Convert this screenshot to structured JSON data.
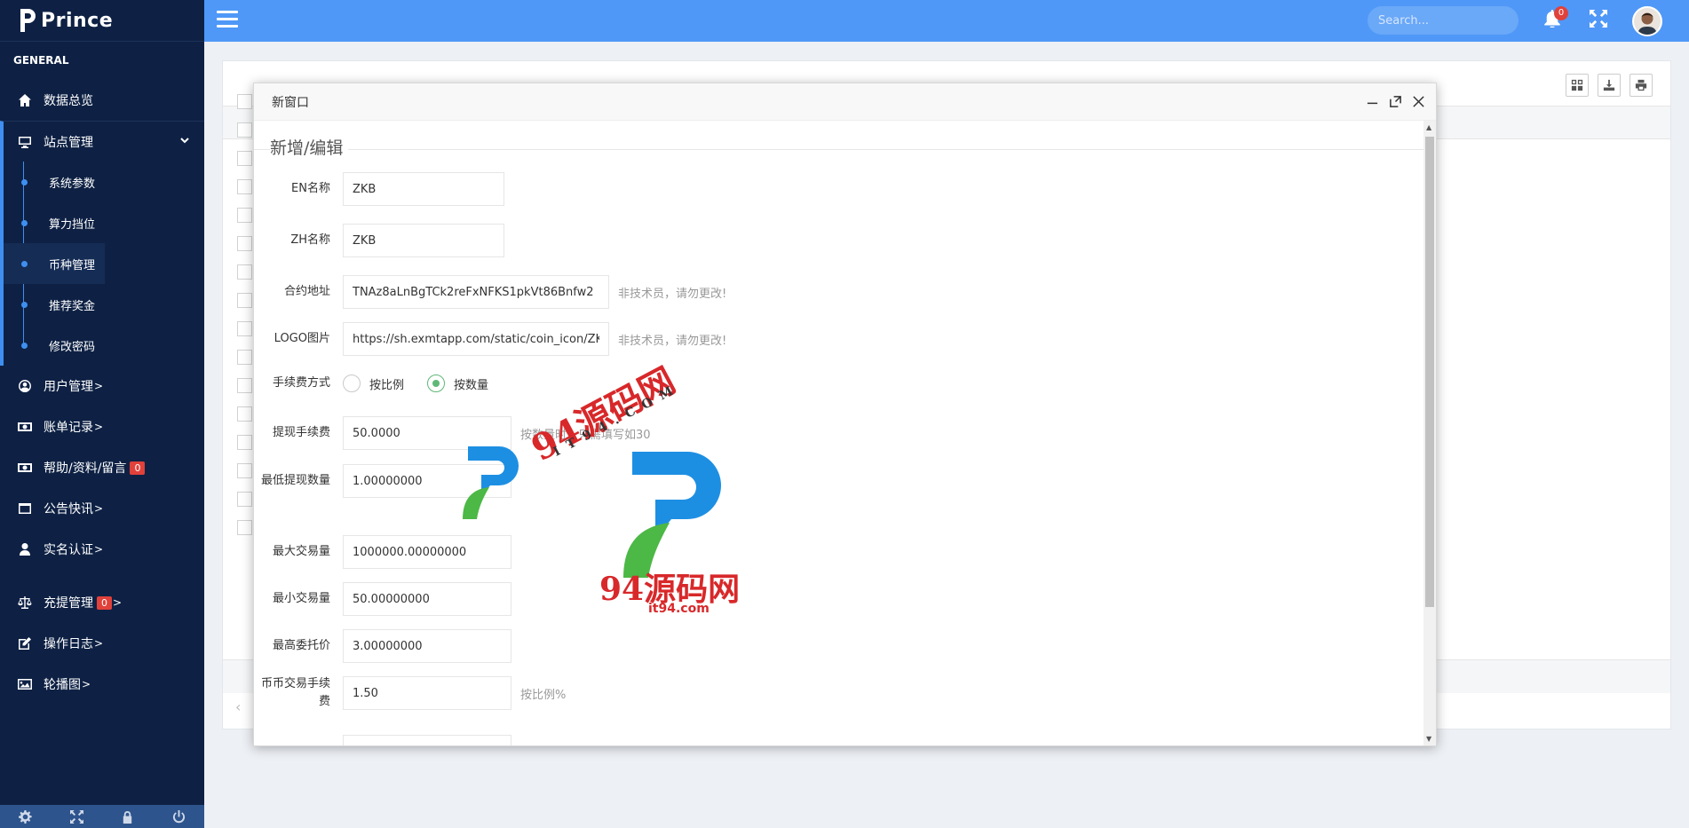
{
  "brand": {
    "name": "Prince"
  },
  "sidebar": {
    "section_title": "GENERAL",
    "items": [
      {
        "label": "数据总览",
        "icon": "home-icon"
      },
      {
        "label": "站点管理",
        "icon": "monitor-icon"
      },
      {
        "label": "用户管理",
        "icon": "user-circle-icon"
      },
      {
        "label": "账单记录",
        "icon": "money-icon"
      },
      {
        "label": "帮助/资料/留言",
        "icon": "money-icon",
        "badge": "0"
      },
      {
        "label": "公告快讯",
        "icon": "window-icon"
      },
      {
        "label": "实名认证",
        "icon": "user-icon"
      },
      {
        "label": "充提管理",
        "icon": "balance-scale-icon",
        "badge": "0"
      },
      {
        "label": "操作日志",
        "icon": "edit-icon"
      },
      {
        "label": "轮播图",
        "icon": "image-icon"
      }
    ],
    "subitems": [
      "系统参数",
      "算力挡位",
      "币种管理",
      "推荐奖金",
      "修改密码"
    ],
    "chevron": ">",
    "footer_icons": [
      "gear-icon",
      "expand-icon",
      "lock-icon",
      "power-icon"
    ]
  },
  "header": {
    "search_placeholder": "Search...",
    "notification_count": "0"
  },
  "dialog": {
    "title": "新窗口",
    "legend": "新增/编辑",
    "fields": {
      "en_name": {
        "label": "EN名称",
        "value": "ZKB"
      },
      "zh_name": {
        "label": "ZH名称",
        "value": "ZKB"
      },
      "contract": {
        "label": "合约地址",
        "value": "TNAz8aLnBgTCk2reFxNFKS1pkVt86Bnfw2",
        "hint": "非技术员，请勿更改!"
      },
      "logo": {
        "label": "LOGO图片",
        "value": "https://sh.exmtapp.com/static/coin_icon/ZKB.png",
        "hint": "非技术员，请勿更改!"
      },
      "fee_mode": {
        "label": "手续费方式",
        "options": [
          "按比例",
          "按数量"
        ],
        "selected": "按数量"
      },
      "withdraw_fee": {
        "label": "提现手续费",
        "value": "50.0000",
        "hint": "按数量时，只需填写如30"
      },
      "min_withdraw": {
        "label": "最低提现数量",
        "value": "1.00000000"
      },
      "max_trade": {
        "label": "最大交易量",
        "value": "1000000.00000000"
      },
      "min_trade": {
        "label": "最小交易量",
        "value": "50.00000000"
      },
      "max_order_price": {
        "label": "最高委托价",
        "value": "3.00000000"
      },
      "trade_fee": {
        "label": "币币交易手续费",
        "value": "1.50",
        "hint": "按比例%"
      }
    }
  },
  "watermark": {
    "text": "94源码网",
    "small": "IT94.COM",
    "domain": "it94.com"
  },
  "colors": {
    "header": "#4f98f7",
    "sidebar": "#0e2144",
    "accent": "#3e8ff0",
    "badge": "#e0413a",
    "radio_on": "#5fb878"
  }
}
